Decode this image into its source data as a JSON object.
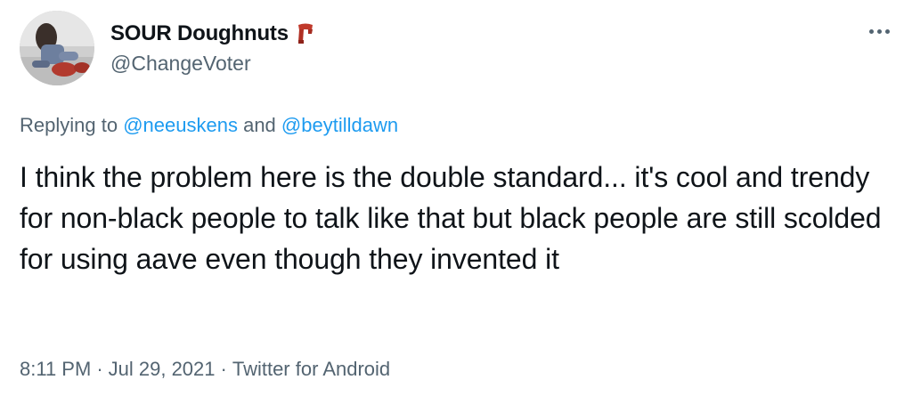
{
  "author": {
    "display_name": "SOUR Doughnuts",
    "name_emoji": "scarf-emoji-icon",
    "handle": "@ChangeVoter",
    "avatar": "profile-photo"
  },
  "menu": {
    "more_icon": "more-horizontal-icon"
  },
  "reply_context": {
    "prefix": "Replying to",
    "mention_1": "@neeuskens",
    "conjunction": "and",
    "mention_2": "@beytilldawn"
  },
  "tweet": {
    "text": "I think the problem here is the double standard... it's cool and trendy for non-black people to talk like that but black people are still scolded for using aave even though they invented it"
  },
  "meta": {
    "time": "8:11 PM",
    "separator": "·",
    "date": "Jul 29, 2021",
    "source": "Twitter for Android"
  },
  "colors": {
    "text": "#0f1419",
    "secondary": "#536471",
    "link": "#1d9bf0",
    "scarf": "#c0392b"
  }
}
